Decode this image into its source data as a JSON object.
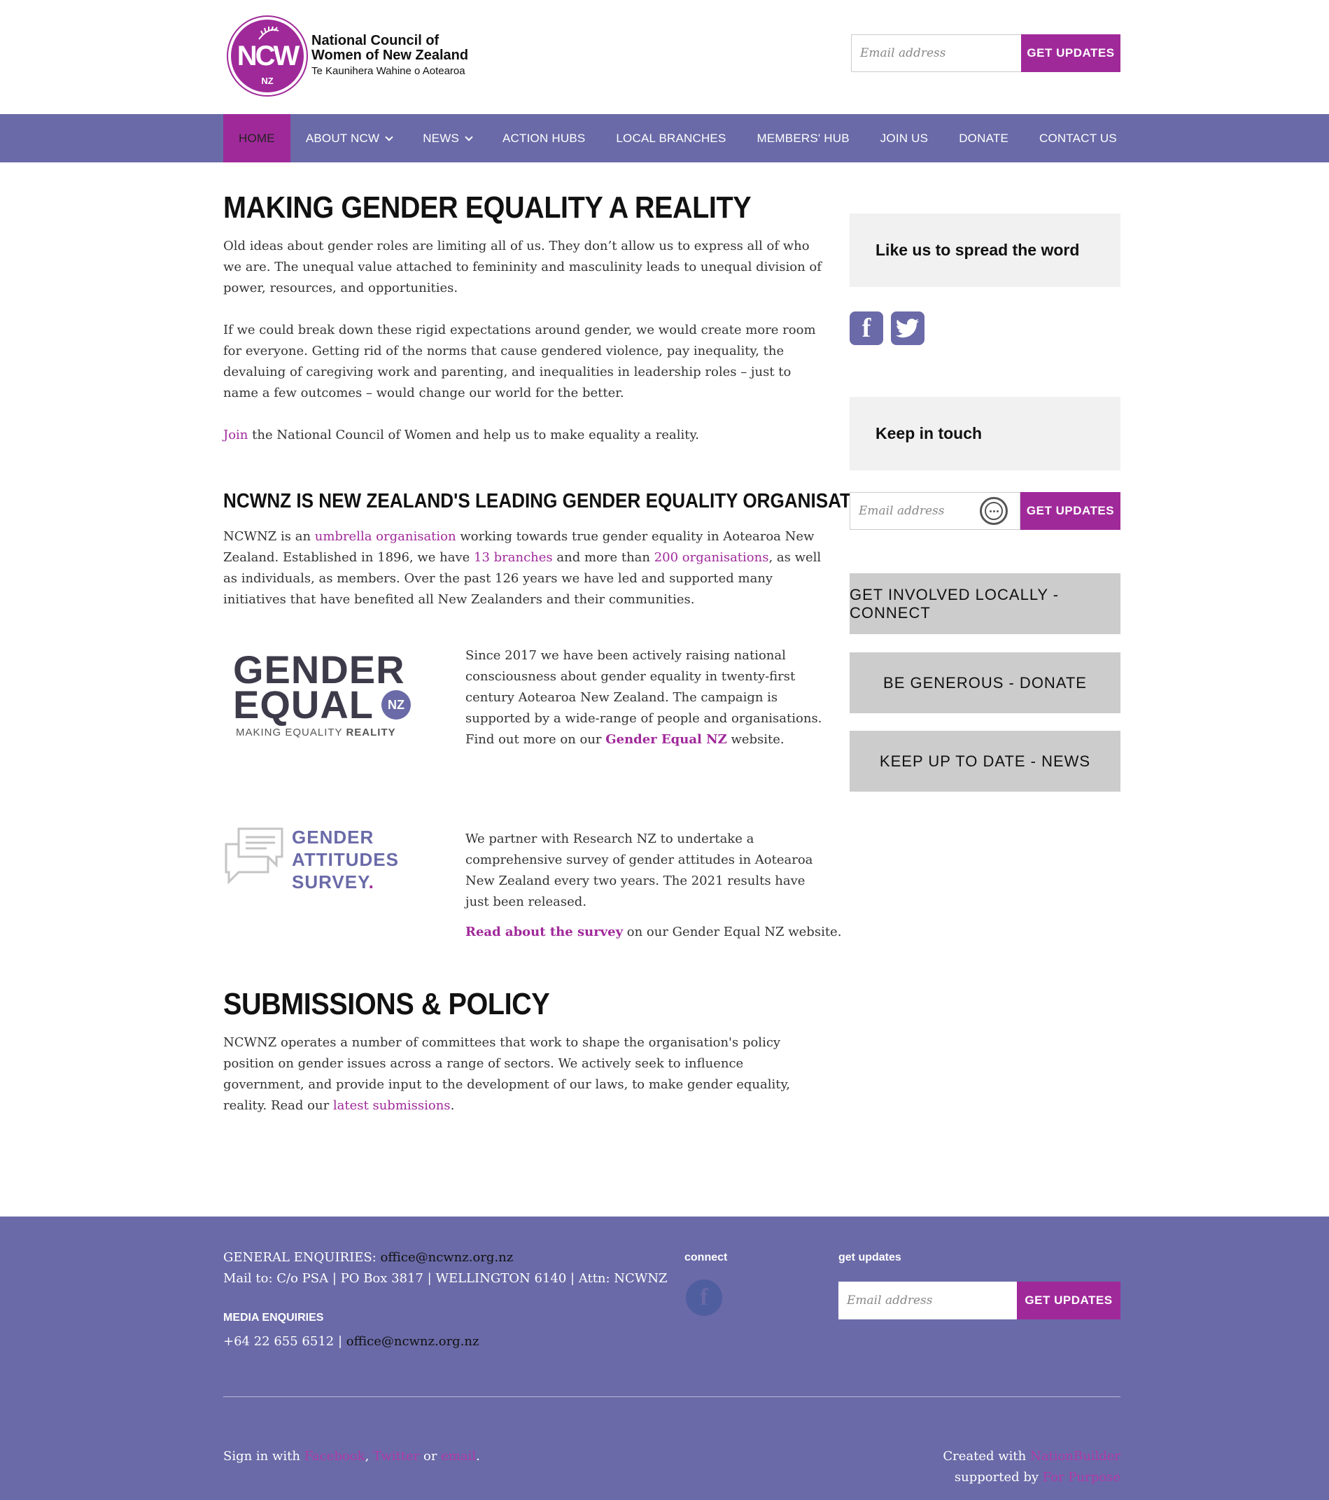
{
  "header": {
    "logo_monogram": "NCW",
    "logo_nz": "NZ",
    "logo_line1": "National Council of",
    "logo_line2": "Women of New Zealand",
    "logo_line3": "Te Kaunihera Wahine o Aotearoa",
    "email_placeholder": "Email address",
    "updates_button": "GET UPDATES"
  },
  "nav": {
    "items": [
      {
        "label": "HOME",
        "dropdown": false,
        "active": true
      },
      {
        "label": "ABOUT NCW",
        "dropdown": true
      },
      {
        "label": "NEWS",
        "dropdown": true
      },
      {
        "label": "ACTION HUBS",
        "dropdown": false
      },
      {
        "label": "LOCAL BRANCHES",
        "dropdown": false
      },
      {
        "label": "MEMBERS' HUB",
        "dropdown": false
      },
      {
        "label": "JOIN US",
        "dropdown": false
      },
      {
        "label": "DONATE",
        "dropdown": false
      },
      {
        "label": "CONTACT US",
        "dropdown": false
      }
    ]
  },
  "main": {
    "title": "MAKING GENDER EQUALITY A REALITY",
    "para1": "Old ideas about gender roles are limiting all of us.  They don’t allow us to express all of who we are. The unequal value attached to femininity and masculinity leads to unequal division of power, resources, and opportunities.",
    "para2": "If we could break down these rigid expectations around gender, we would create more room for everyone. Getting rid of the norms that cause gendered violence, pay inequality, the devaluing of caregiving work and parenting, and inequalities in leadership roles – just to name a few outcomes – would change our world for the better.",
    "join_link": "Join",
    "join_rest": " the National Council of Women and help us to make equality a reality.",
    "heading2": "NCWNZ IS NEW ZEALAND'S LEADING GENDER EQUALITY ORGANISATION.",
    "about": {
      "t1": "NCWNZ is an ",
      "link1": "umbrella organisation",
      "t2": " working towards true gender equality in Aotearoa New Zealand. Established in 1896, we have ",
      "link2": "13 branches",
      "t3": " and more than ",
      "link3": "200 organisations",
      "t4": ", as well as individuals, as members. Over the past 126 years we have led and supported many initiatives that have benefited all New Zealanders and their communities."
    },
    "gender_equal": {
      "logo_l1": "GENDER",
      "logo_l2": "EQUAL",
      "logo_nz": "NZ",
      "logo_tag1": "MAKING EQUALITY ",
      "logo_tag2": "REALITY",
      "text": "Since 2017 we have been actively raising national consciousness about gender equality in twenty-first century Aotearoa New Zealand. The campaign is supported by a wide-range of people and organisations. Find out more on our ",
      "link": "Gender Equal NZ",
      "text_end": " website."
    },
    "survey": {
      "logo_l1": "GENDER",
      "logo_l2": "ATTITUDES",
      "logo_l3": "SURVEY",
      "logo_dot": ".",
      "text": "We partner with Research NZ to undertake a comprehensive survey of gender attitudes in Aotearoa New Zealand every two years. The 2021 results have just been released.",
      "link": "Read about the survey",
      "link_rest": " on our Gender Equal NZ website."
    },
    "policy_title": "SUBMISSIONS & POLICY",
    "policy_text": "NCWNZ operates a number of committees that work to shape the organisation's policy position on gender issues across a range of sectors. We actively seek to influence government, and provide input to the development of our laws, to make gender equality, reality. Read our ",
    "policy_link": "latest submissions",
    "policy_end": "."
  },
  "sidebar": {
    "like_title": "Like us to spread the word",
    "facebook_glyph": "f",
    "keep_title": "Keep in touch",
    "email_placeholder": "Email address",
    "updates_button": "GET UPDATES",
    "cta1": "GET INVOLVED LOCALLY - CONNECT",
    "cta2": "BE GENEROUS - DONATE",
    "cta3": "KEEP UP TO DATE - NEWS"
  },
  "footer": {
    "general_label": "GENERAL ENQUIRIES: ",
    "general_email": "office@ncwnz.org.nz",
    "mail_line": "Mail to: C/o PSA | PO Box 3817 | WELLINGTON 6140 | Attn: NCWNZ",
    "media_label": "MEDIA ENQUIRIES",
    "media_phone": "+64 22 655 6512 | ",
    "media_email": "office@ncwnz.org.nz",
    "connect_label": "connect",
    "facebook_glyph": "f",
    "updates_label": "get updates",
    "email_placeholder": "Email address",
    "updates_button": "GET UPDATES",
    "signin_text": "Sign in with ",
    "signin_facebook": "Facebook",
    "signin_comma": ", ",
    "signin_twitter": "Twitter",
    "signin_or": " or ",
    "signin_email": "email",
    "signin_end": ".",
    "created_text": "Created with ",
    "created_link": "NationBuilder",
    "supported_text": "supported by ",
    "supported_link": "For Purpose"
  },
  "colors": {
    "brand_purple": "#a0299a",
    "nav_blue": "#6a6aa8",
    "sidebar_grey": "#f1f1f1",
    "cta_grey": "#cccccc"
  }
}
